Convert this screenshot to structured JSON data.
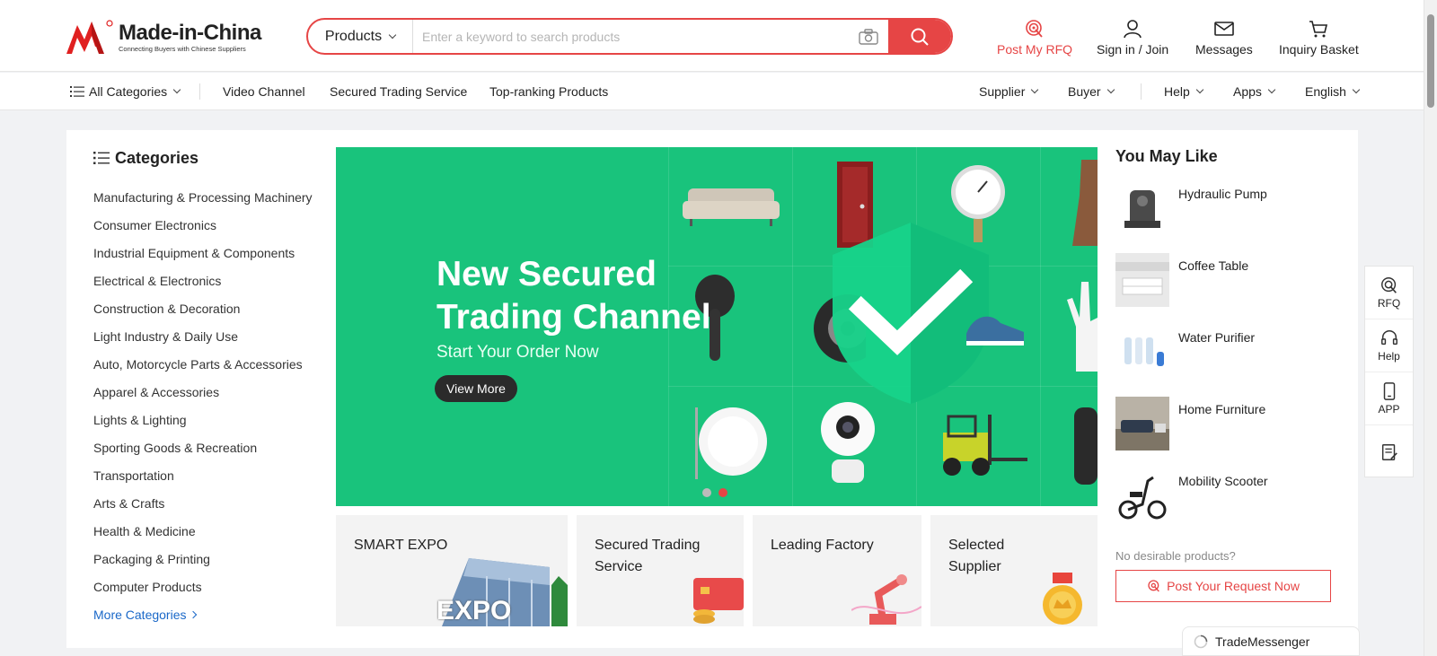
{
  "brand": {
    "name": "Made-in-China",
    "tagline": "Connecting Buyers with Chinese Suppliers",
    "accent": "#e64545"
  },
  "search": {
    "category": "Products",
    "placeholder": "Enter a keyword to search products"
  },
  "header_actions": {
    "rfq": "Post My RFQ",
    "signin": "Sign in / Join",
    "messages": "Messages",
    "basket": "Inquiry Basket"
  },
  "nav": {
    "all_categories": "All Categories",
    "links": [
      "Video Channel",
      "Secured Trading Service",
      "Top-ranking Products"
    ],
    "right": [
      "Supplier",
      "Buyer",
      "Help",
      "Apps",
      "English"
    ]
  },
  "categories": {
    "title": "Categories",
    "items": [
      "Manufacturing & Processing Machinery",
      "Consumer Electronics",
      "Industrial Equipment & Components",
      "Electrical & Electronics",
      "Construction & Decoration",
      "Light Industry & Daily Use",
      "Auto, Motorcycle Parts & Accessories",
      "Apparel & Accessories",
      "Lights & Lighting",
      "Sporting Goods & Recreation",
      "Transportation",
      "Arts & Crafts",
      "Health & Medicine",
      "Packaging & Printing",
      "Computer Products"
    ],
    "more": "More Categories"
  },
  "banner": {
    "title_line1": "New Secured",
    "title_line2": "Trading Channel",
    "subtitle": "Start Your Order Now",
    "button": "View More",
    "bg_color": "#19c37c"
  },
  "cards": {
    "smart_expo": "SMART EXPO",
    "expo_overlay": "EXPO",
    "secured_line1": "Secured Trading",
    "secured_line2": "Service",
    "leading_factory": "Leading Factory",
    "selected_line1": "Selected",
    "selected_line2": "Supplier"
  },
  "you_may_like": {
    "title": "You May Like",
    "items": [
      "Hydraulic Pump",
      "Coffee Table",
      "Water Purifier",
      "Home Furniture",
      "Mobility Scooter"
    ],
    "no_desire": "No desirable products?",
    "post_request": "Post Your Request Now"
  },
  "float_bar": {
    "rfq": "RFQ",
    "help": "Help",
    "app": "APP"
  },
  "trade_messenger": "TradeMessenger"
}
